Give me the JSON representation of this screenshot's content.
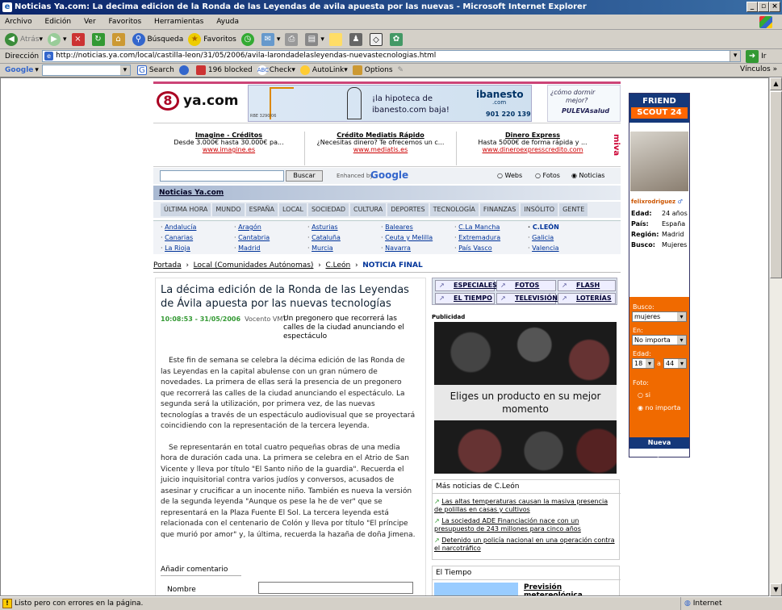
{
  "window": {
    "title": "Noticias Ya.com: La decima edicion de la Ronda de las Leyendas de avila apuesta por las nuevas  - Microsoft Internet Explorer",
    "min": "_",
    "max": "▫",
    "close": "×"
  },
  "menu": [
    "Archivo",
    "Edición",
    "Ver",
    "Favoritos",
    "Herramientas",
    "Ayuda"
  ],
  "toolbar": {
    "back": "Atrás",
    "search": "Búsqueda",
    "favorites": "Favoritos"
  },
  "address": {
    "label": "Dirección",
    "url": "http://noticias.ya.com/local/castilla-leon/31/05/2006/avila-larondadelasleyendas-nuevastecnologias.html",
    "go": "Ir",
    "links": "Vínculos"
  },
  "googlebar": {
    "brand": "Google",
    "search": "Search",
    "blocked": "196 blocked",
    "check": "Check",
    "autolink": "AutoLink",
    "options": "Options"
  },
  "header": {
    "logo": "ya.com",
    "banner_text": "¡la hipoteca de ibanesto.com baja!",
    "banner_small": "RBE 3290/06",
    "banner_brand": "ibanesto",
    "banner_brand_sub": ".com",
    "banner_phone": "901 220 139",
    "pulev1": "¿cómo dormir",
    "pulev2": "mejor?",
    "pulev3": "PULEVAsalud"
  },
  "ads": [
    {
      "title": "Imagine - Créditos",
      "desc": "Desde 3.000€ hasta 30.000€ pa...",
      "url": "www.imagine.es"
    },
    {
      "title": "Crédito Mediatis Rápido",
      "desc": "¿Necesitas dinero? Te ofrecemos un c...",
      "url": "www.mediatis.es"
    },
    {
      "title": "Dinero Express",
      "desc": "Hasta 5000€ de forma rápida y ...",
      "url": "www.dineroexpresscredito.com"
    }
  ],
  "ads_vertical": "miva",
  "search": {
    "button": "Buscar",
    "enhanced": "Enhanced by",
    "google": "Google",
    "opt1": "Webs",
    "opt2": "Fotos",
    "opt3": "Noticias"
  },
  "section_title": "Noticias Ya.com",
  "nav": [
    "ÚLTIMA HORA",
    "MUNDO",
    "ESPAÑA",
    "LOCAL",
    "SOCIEDAD",
    "CULTURA",
    "DEPORTES",
    "TECNOLOGÍA",
    "FINANZAS",
    "INSÓLITO",
    "GENTE"
  ],
  "regions": [
    [
      "Andalucía",
      "Aragón",
      "Asturias",
      "Baleares",
      "C.La Mancha",
      "C.LEÓN"
    ],
    [
      "Canarias",
      "Cantabria",
      "Cataluña",
      "Ceuta y Melilla",
      "Extremadura",
      "Galicia"
    ],
    [
      "La Rioja",
      "Madrid",
      "Murcia",
      "Navarra",
      "País Vasco",
      "Valencia"
    ]
  ],
  "breadcrumb": {
    "b1": "Portada",
    "b2": "Local (Comunidades Autónomas)",
    "b3": "C.León",
    "b4": "NOTICIA FINAL"
  },
  "article": {
    "title": "La décima edición de la Ronda de las Leyendas de Ávila apuesta por las nuevas tecnologías",
    "time": "10:08:53 - 31/05/2006",
    "source": "Vocento VMT -",
    "lead": "Un pregonero que recorrerá las calles de la ciudad anunciando el espectáculo",
    "p1": "Este fin de semana se celebra la décima edición de las Ronda de las Leyendas en la capital abulense con un gran número de novedades. La primera de ellas será la presencia de un pregonero que recorrerá las calles de la ciudad anunciando el espectáculo. La segunda será la utilización, por primera vez, de las nuevas tecnologías a través de un espectáculo audiovisual que se proyectará coincidiendo con la representación de la tercera leyenda.",
    "p2": "Se representarán en total cuatro pequeñas obras de una media hora de duración cada una. La primera se celebra en el Atrio de San Vicente y lleva por título \"El Santo niño de la guardia\". Recuerda el juicio inquisitorial contra varios judíos y conversos, acusados de asesinar y crucificar a un inocente niño. También es nueva la versión de la segunda leyenda \"Aunque os pese la he de ver\" que se representará en la Plaza Fuente El Sol. La tercera leyenda está relacionada con el centenario de Colón y lleva por título \"El príncipe que murió por amor\" y, la última, recuerda la hazaña de doña Jimena.",
    "comment": "Añadir comentario",
    "name_label": "Nombre"
  },
  "quicklinks": [
    "ESPECIALES",
    "FOTOS",
    "FLASH",
    "EL TIEMPO",
    "TELEVISIÓN",
    "LOTERÍAS"
  ],
  "publicidad": "Publicidad",
  "ad_image_text": "Eliges un producto en su mejor momento",
  "more": {
    "title": "Más noticias de C.León",
    "items": [
      "Las altas temperaturas causan la masiva presencia de polillas en casas y cultivos",
      "La sociedad ADE Financiación nace con un presupuesto de 243 millones para cinco años",
      "Detenido un policía nacional en una operación contra el narcotráfico"
    ]
  },
  "weather": {
    "title": "El Tiempo",
    "link": "Previsión metereológica"
  },
  "friendscout": {
    "brand1": "FRIEND",
    "brand2": "SCOUT 24",
    "user": "felixrodriguez",
    "l_edad": "Edad:",
    "v_edad": "24 años",
    "l_pais": "País:",
    "v_pais": "España",
    "l_region": "Región:",
    "v_region": "Madrid",
    "l_busco": "Busco:",
    "v_busco": "Mujeres",
    "busco": "Busco:",
    "busco_val": "mujeres",
    "en": "En:",
    "en_val": "No importa",
    "edad": "Edad:",
    "edad_from": "18",
    "edad_y": "a",
    "edad_to": "44",
    "foto": "Foto:",
    "si": "si",
    "no": "no importa",
    "nueva": "Nueva búsqueda"
  },
  "status": {
    "text": "Listo pero con errores en la página.",
    "zone": "Internet"
  },
  "colors": {
    "titlebar": "#0a246a",
    "nav": "#cdd6e3",
    "orange": "#f06a00",
    "link": "#003399"
  }
}
